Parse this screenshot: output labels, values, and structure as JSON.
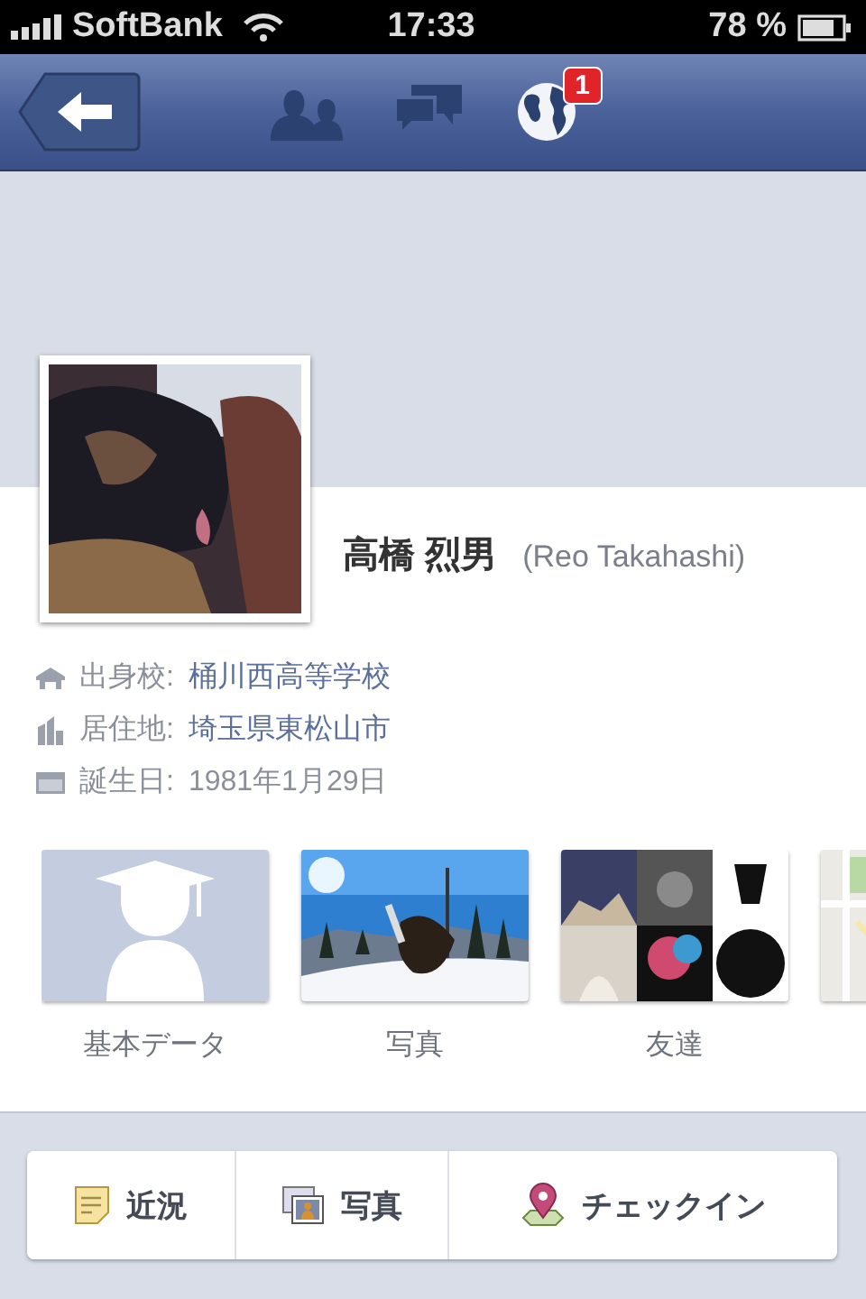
{
  "status_bar": {
    "carrier": "SoftBank",
    "time": "17:33",
    "battery": "78 %"
  },
  "nav_bar": {
    "buttons": [
      {
        "kind": "friends"
      },
      {
        "kind": "messages"
      },
      {
        "kind": "notifications",
        "badge": "1"
      }
    ]
  },
  "profile": {
    "name": "高橋 烈男",
    "alt_name": "(Reo Takahashi)",
    "info": [
      {
        "kind": "school",
        "label": "出身校:",
        "value": "桶川西高等学校",
        "link": true
      },
      {
        "kind": "home",
        "label": "居住地:",
        "value": "埼玉県東松山市",
        "link": true
      },
      {
        "kind": "birthday",
        "label": "誕生日:",
        "value": "1981年1月29日",
        "link": false
      }
    ]
  },
  "tiles": [
    {
      "kind": "avatar",
      "label": "基本データ"
    },
    {
      "kind": "snow",
      "label": "写真"
    },
    {
      "kind": "collage",
      "label": "友達"
    },
    {
      "kind": "map"
    }
  ],
  "actions": [
    {
      "kind": "status",
      "label": "近況"
    },
    {
      "label": "写真"
    },
    {
      "kind": "checkin",
      "label": "チェックイン"
    }
  ]
}
